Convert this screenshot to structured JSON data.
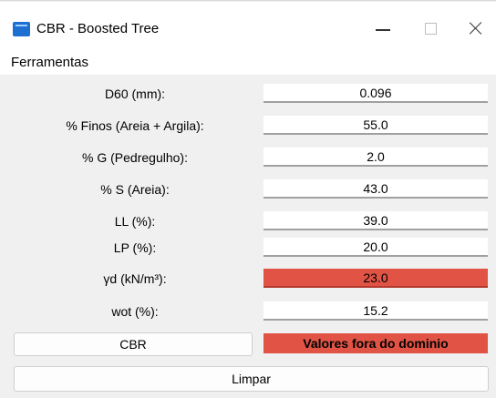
{
  "window": {
    "title": "CBR - Boosted Tree",
    "icon": "app-logo-icon"
  },
  "menu": {
    "items": [
      "Ferramentas"
    ]
  },
  "form": {
    "fields": [
      {
        "label": "D60 (mm):",
        "value": "0.096",
        "state": "normal"
      },
      {
        "label": "% Finos (Areia + Argila):",
        "value": "55.0",
        "state": "normal"
      },
      {
        "label": "% G (Pedregulho):",
        "value": "2.0",
        "state": "normal"
      },
      {
        "label": "% S (Areia):",
        "value": "43.0",
        "state": "normal"
      },
      {
        "label": "LL (%):",
        "value": "39.0",
        "state": "normal"
      },
      {
        "label": "LP (%):",
        "value": "20.0",
        "state": "normal"
      },
      {
        "label": "γd (kN/m³):",
        "value": "23.0",
        "state": "out-of-domain"
      },
      {
        "label": "wot (%):",
        "value": "15.2",
        "state": "normal"
      }
    ]
  },
  "actions": {
    "compute_label": "CBR",
    "result_text": "Valores fora do dominio",
    "clear_label": "Limpar"
  },
  "colors": {
    "alert": "#e05345",
    "window_bg": "#f0f0f0"
  }
}
